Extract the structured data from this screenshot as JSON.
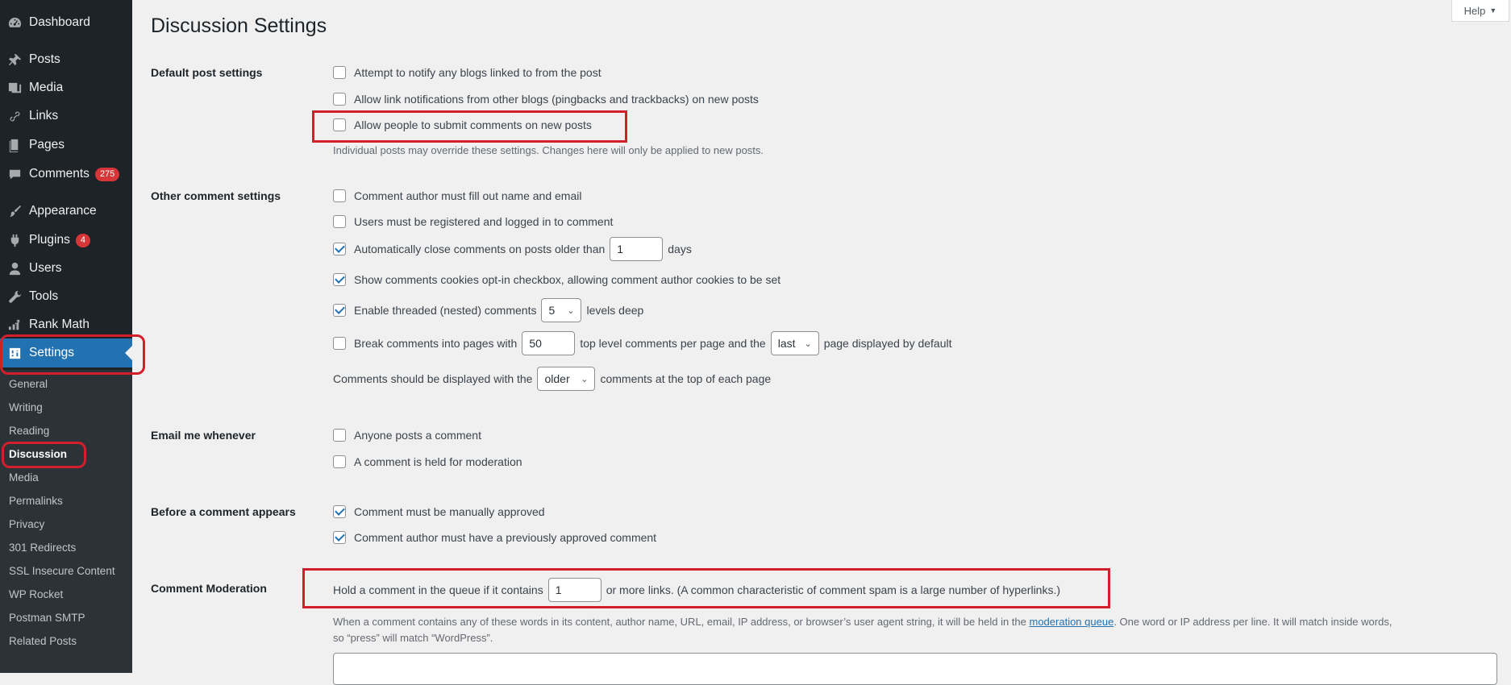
{
  "sidebar": {
    "items": [
      {
        "label": "Dashboard",
        "icon": "dashboard-icon"
      },
      {
        "label": "Posts",
        "icon": "pushpin-icon"
      },
      {
        "label": "Media",
        "icon": "media-icon"
      },
      {
        "label": "Links",
        "icon": "link-icon"
      },
      {
        "label": "Pages",
        "icon": "pages-icon"
      },
      {
        "label": "Comments",
        "icon": "comments-icon",
        "badge": "275"
      },
      {
        "label": "Appearance",
        "icon": "paintbrush-icon"
      },
      {
        "label": "Plugins",
        "icon": "plugin-icon",
        "badge": "4"
      },
      {
        "label": "Users",
        "icon": "users-icon"
      },
      {
        "label": "Tools",
        "icon": "wrench-icon"
      },
      {
        "label": "Rank Math",
        "icon": "rank-math-icon"
      },
      {
        "label": "Settings",
        "icon": "settings-icon"
      }
    ],
    "submenu": [
      "General",
      "Writing",
      "Reading",
      "Discussion",
      "Media",
      "Permalinks",
      "Privacy",
      "301 Redirects",
      "SSL Insecure Content",
      "WP Rocket",
      "Postman SMTP",
      "Related Posts"
    ],
    "active_item": "Settings",
    "current_submenu": "Discussion"
  },
  "header": {
    "help_label": "Help"
  },
  "page_title": "Discussion Settings",
  "sections": {
    "default_post": {
      "label": "Default post settings",
      "opt1": "Attempt to notify any blogs linked to from the post",
      "opt2": "Allow link notifications from other blogs (pingbacks and trackbacks) on new posts",
      "opt3": "Allow people to submit comments on new posts",
      "note": "Individual posts may override these settings. Changes here will only be applied to new posts."
    },
    "other_comment": {
      "label": "Other comment settings",
      "opt1": "Comment author must fill out name and email",
      "opt2": "Users must be registered and logged in to comment",
      "opt3_prefix": "Automatically close comments on posts older than",
      "opt3_value": "1",
      "opt3_suffix": "days",
      "opt4": "Show comments cookies opt-in checkbox, allowing comment author cookies to be set",
      "opt5_prefix": "Enable threaded (nested) comments",
      "opt5_value": "5",
      "opt5_suffix": "levels deep",
      "opt6_prefix": "Break comments into pages with",
      "opt6_value": "50",
      "opt6_middle": "top level comments per page and the",
      "opt6_select": "last",
      "opt6_suffix": "page displayed by default",
      "order_prefix": "Comments should be displayed with the",
      "order_select": "older",
      "order_suffix": "comments at the top of each page"
    },
    "email": {
      "label": "Email me whenever",
      "opt1": "Anyone posts a comment",
      "opt2": "A comment is held for moderation"
    },
    "before_appears": {
      "label": "Before a comment appears",
      "opt1": "Comment must be manually approved",
      "opt2": "Comment author must have a previously approved comment"
    },
    "moderation": {
      "label": "Comment Moderation",
      "hold_prefix": "Hold a comment in the queue if it contains",
      "hold_value": "1",
      "hold_suffix": "or more links. (A common characteristic of comment spam is a large number of hyperlinks.)",
      "desc_prefix": "When a comment contains any of these words in its content, author name, URL, email, IP address, or browser’s user agent string, it will be held in the",
      "desc_link": "moderation queue",
      "desc_suffix": ". One word or IP address per line. It will match inside words,",
      "desc_line2": "so “press” will match “WordPress”."
    }
  },
  "checkbox_states": {
    "default_post": [
      false,
      false,
      false
    ],
    "other_comment": [
      false,
      false,
      true,
      true,
      true,
      false
    ],
    "email": [
      false,
      false
    ],
    "before_appears": [
      true,
      true
    ]
  },
  "colors": {
    "sidebar_bg": "#1d2327",
    "submenu_bg": "#2c3338",
    "accent": "#2271b1",
    "badge": "#d63638",
    "highlight": "#d21f2b"
  }
}
